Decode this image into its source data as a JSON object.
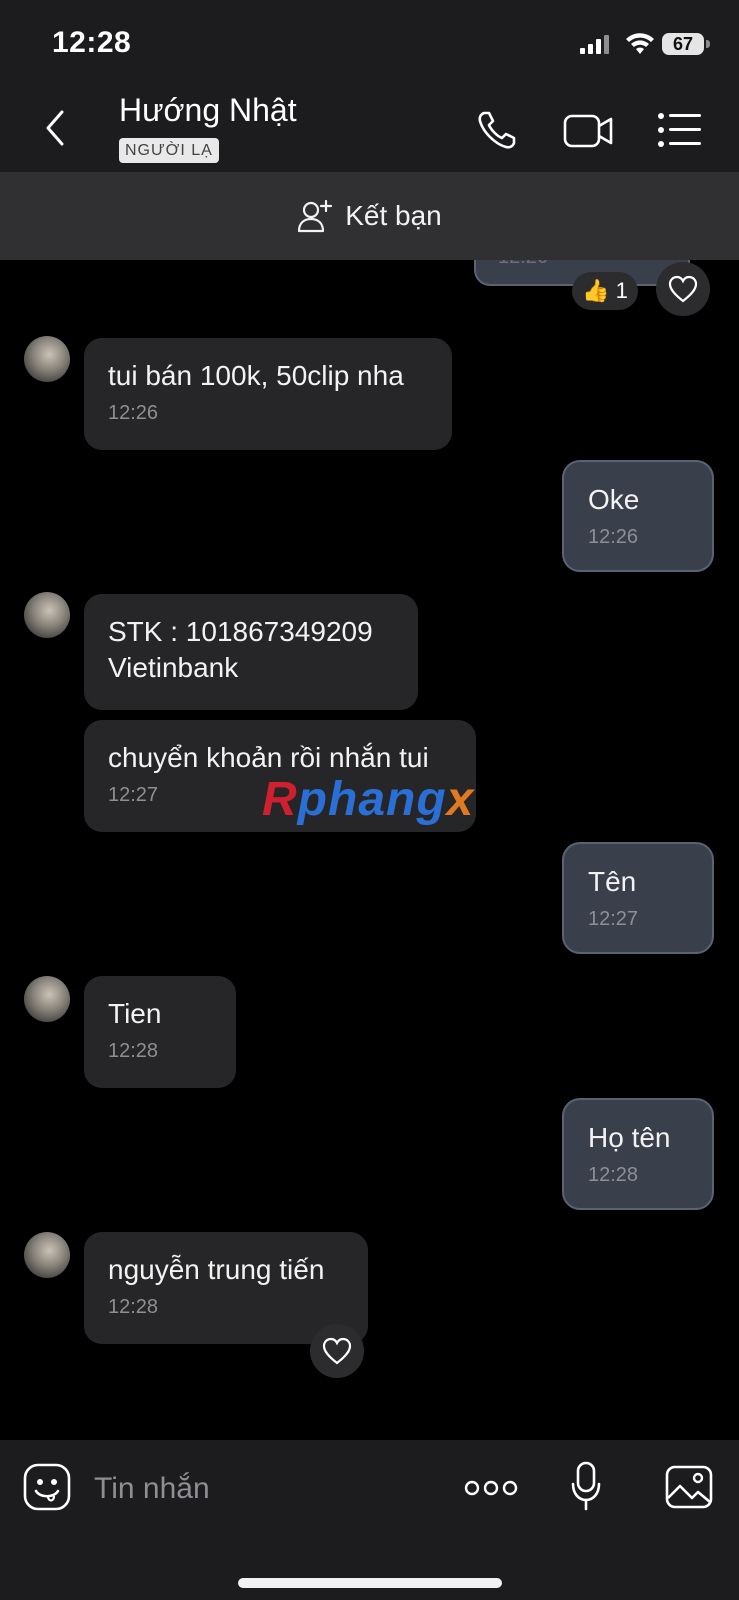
{
  "status_bar": {
    "time": "12:28",
    "battery": "67"
  },
  "header": {
    "contact_name": "Hướng Nhật",
    "badge": "NGƯỜI LẠ"
  },
  "add_friend": {
    "label": "Kết bạn"
  },
  "earlier": {
    "partial_time": "12:26",
    "reaction_emoji": "👍",
    "reaction_count": "1"
  },
  "messages": [
    {
      "side": "in",
      "text": "tui bán 100k, 50clip nha",
      "time": "12:26"
    },
    {
      "side": "out",
      "text": "Oke",
      "time": "12:26"
    },
    {
      "side": "in",
      "text": "STK : 101867349209\nVietinbank",
      "time": ""
    },
    {
      "side": "in",
      "text": "chuyển khoản rồi nhắn tui",
      "time": "12:27"
    },
    {
      "side": "out",
      "text": "Tên",
      "time": "12:27"
    },
    {
      "side": "in",
      "text": "Tien",
      "time": "12:28"
    },
    {
      "side": "out",
      "text": "Họ tên",
      "time": "12:28"
    },
    {
      "side": "in",
      "text": "nguyễn trung tiến",
      "time": "12:28"
    }
  ],
  "watermark": {
    "r": "R",
    "phang": "phang",
    "x": "x"
  },
  "composer": {
    "placeholder": "Tin nhắn"
  },
  "icons": {
    "back": "chevron-left-icon",
    "call": "phone-icon",
    "video": "video-camera-icon",
    "menu": "list-menu-icon",
    "add_friend": "add-person-icon",
    "heart": "heart-icon",
    "emoji": "emoji-icon",
    "more": "more-dots-icon",
    "mic": "microphone-icon",
    "image": "image-icon"
  },
  "colors": {
    "header_bg": "#1c1c1e",
    "incoming_bubble": "#262628",
    "outgoing_bubble": "#3a3f4c",
    "outgoing_border": "#5a6273"
  }
}
